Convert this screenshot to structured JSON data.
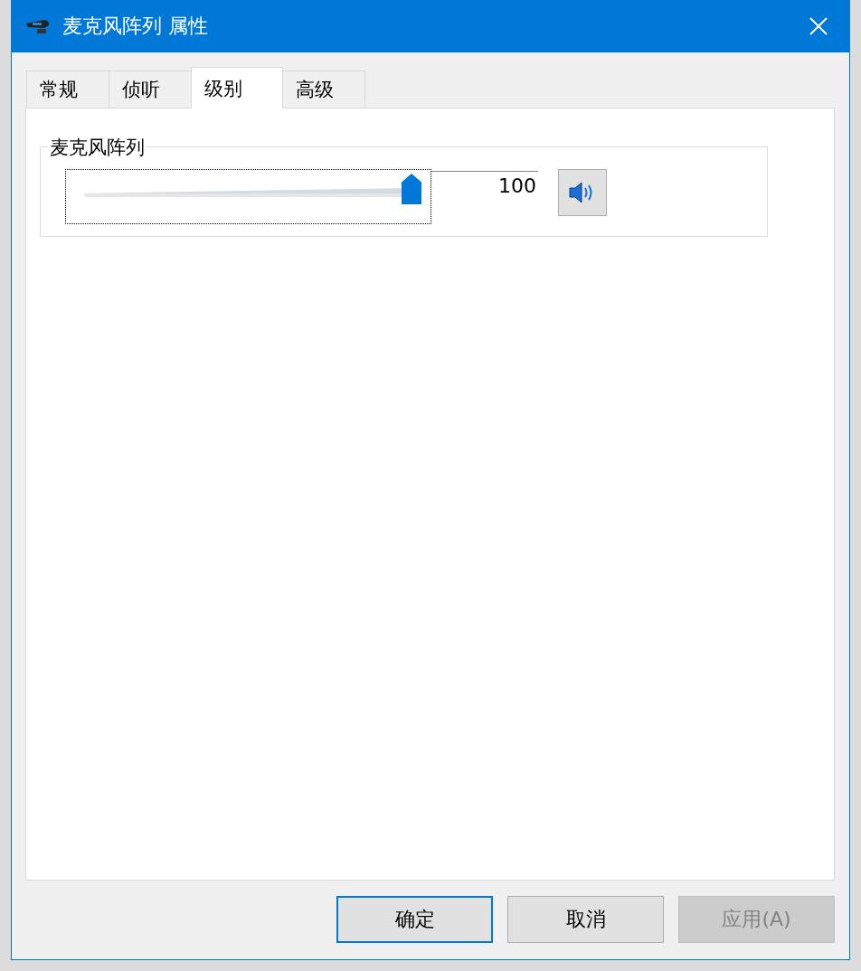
{
  "window": {
    "title": "麦克风阵列 属性"
  },
  "tabs": [
    {
      "label": "常规",
      "selected": false
    },
    {
      "label": "侦听",
      "selected": false
    },
    {
      "label": "级别",
      "selected": true
    },
    {
      "label": "高级",
      "selected": false
    }
  ],
  "group": {
    "title": "麦克风阵列",
    "level": 1.0,
    "reading": "100",
    "muted": false
  },
  "buttons": [
    {
      "label": "确定",
      "kind": "default",
      "disabled": false
    },
    {
      "label": "取消",
      "kind": "normal",
      "disabled": false
    },
    {
      "label": "应用(A)",
      "kind": "normal",
      "disabled": true
    }
  ]
}
